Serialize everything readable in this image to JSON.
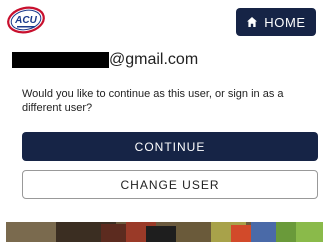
{
  "header": {
    "logo_text": "ACU",
    "home_button_label": "HOME",
    "home_icon": "home-icon"
  },
  "account": {
    "email_visible_part": "@gmail.com"
  },
  "prompt": {
    "text": "Would you like to continue as this user, or sign in as a different user?"
  },
  "actions": {
    "continue_label": "CONTINUE",
    "change_user_label": "CHANGE USER"
  },
  "colors": {
    "primary": "#162446",
    "logo_red": "#c8102e",
    "logo_blue": "#1b3a8c"
  }
}
